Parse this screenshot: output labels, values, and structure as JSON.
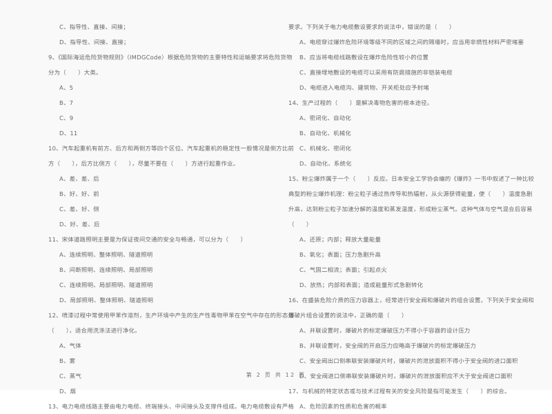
{
  "document": {
    "type": "exam-paper-scan",
    "language": "zh-CN",
    "footer": "第 2 页 共 12 页"
  },
  "left_column": {
    "blocks": [
      {
        "id": "q8-options-tail",
        "lines": [
          {
            "kind": "option",
            "text": "C、指导性、直接、间接；"
          },
          {
            "kind": "option",
            "text": "D、指导性、间接、直接；"
          }
        ]
      },
      {
        "id": "q9",
        "lines": [
          {
            "kind": "stem",
            "text": "9、《国际海运危险货物规则》（IMDGCode）根据危险货物的主要特性和运输要求将危险货物"
          },
          {
            "kind": "stem-cont",
            "text": "分为（　　）大类。"
          },
          {
            "kind": "option",
            "text": "A、5"
          },
          {
            "kind": "option",
            "text": "B、7"
          },
          {
            "kind": "option",
            "text": "C、9"
          },
          {
            "kind": "option",
            "text": "D、11"
          }
        ]
      },
      {
        "id": "q10",
        "lines": [
          {
            "kind": "stem",
            "text": "10、汽车起重机有前方、后方和两侧方等四个区位。汽车起重机的稳定性一般情况是侧方比前"
          },
          {
            "kind": "stem-cont",
            "text": "方（　　），后方比侧方（　　），尽量不要在（　　）方进行起重作业。"
          },
          {
            "kind": "option",
            "text": "A、差、差、后"
          },
          {
            "kind": "option",
            "text": "B、好、好、前"
          },
          {
            "kind": "option",
            "text": "C、差、好、侧"
          },
          {
            "kind": "option",
            "text": "D、好、差、后"
          }
        ]
      },
      {
        "id": "q11",
        "lines": [
          {
            "kind": "stem",
            "text": "11、宋体道路照明主要是为保证夜间交通的安全与畅通，可以分为（　　）"
          },
          {
            "kind": "option",
            "text": "A、连续照明、整体照明、隧道照明"
          },
          {
            "kind": "option",
            "text": "B、间断照明、连续照明、局部照明"
          },
          {
            "kind": "option",
            "text": "C、连续照明、局部照明、隧道照明"
          },
          {
            "kind": "option",
            "text": "D、局部照明、整体照明、隧道照明"
          }
        ]
      },
      {
        "id": "q12",
        "lines": [
          {
            "kind": "stem",
            "text": "12、喷漆过程中常使用甲苯作溶剂，生产环境中产生的生产性毒物甲苯在空气中存在的形态是"
          },
          {
            "kind": "stem-cont",
            "text": "（　　），适合用洗涤法进行净化。"
          },
          {
            "kind": "option",
            "text": "A、气体"
          },
          {
            "kind": "option",
            "text": "B、雾"
          },
          {
            "kind": "option",
            "text": "C、蒸气"
          },
          {
            "kind": "option",
            "text": "D、烟"
          }
        ]
      },
      {
        "id": "q13-stem-start",
        "lines": [
          {
            "kind": "stem",
            "text": "13、电力电缆线路主要由电力电缆、终端接头、中间接头及支撑件组成。电力电缆敷设有严格"
          }
        ]
      }
    ]
  },
  "right_column": {
    "blocks": [
      {
        "id": "q13-cont",
        "lines": [
          {
            "kind": "stem-cont",
            "text": "要求。下列关于电力电缆敷设要求的说法中，错误的是（　　）"
          },
          {
            "kind": "option",
            "text": "A、电缆穿过爆炸危险环境等级不同的区域之间的隔墙时，应当用非燃性材料严密堵塞"
          },
          {
            "kind": "option",
            "text": "B、应当将电缆线路敷设在爆炸危险性较小的位置"
          },
          {
            "kind": "option",
            "text": "C、直接埋地敷设的电缆可以采用有防腐措施的非铠装电缆"
          },
          {
            "kind": "option",
            "text": "D、电缆进入电缆沟、建筑物、开关柜处应予封堵"
          }
        ]
      },
      {
        "id": "q14",
        "lines": [
          {
            "kind": "stem",
            "text": "14、生产过程的（　　）是解决毒物危害的根本途径。"
          },
          {
            "kind": "option",
            "text": "A、密闭化、自动化"
          },
          {
            "kind": "option",
            "text": "B、自动化、机械化"
          },
          {
            "kind": "option",
            "text": "C、机械化、密闭化"
          },
          {
            "kind": "option",
            "text": "D、自动化、系统化"
          }
        ]
      },
      {
        "id": "q15",
        "lines": [
          {
            "kind": "stem",
            "text": "15、粉尘爆炸属于一个（　　）反应。日本安全工学协会编的《爆炸》一书中叙述了一种比较"
          },
          {
            "kind": "stem-cont",
            "text": "典型的粉尘爆炸机理：粉尘粒子通过热传导和热辐射，从火源获得能量，使（　　）温度急剧"
          },
          {
            "kind": "stem-cont",
            "text": "升高，达到粉尘粒子加速分解的温度和蒸发温度，形成粉尘蒸气。这种气体与空气混合后容易"
          },
          {
            "kind": "stem-cont",
            "text": "（　　）"
          },
          {
            "kind": "option",
            "text": "A、还原；内部；释放大量能量"
          },
          {
            "kind": "option",
            "text": "B、氧化；表面；压力急剧升高"
          },
          {
            "kind": "option",
            "text": "C、气固二相流；表面；引起点火"
          },
          {
            "kind": "option",
            "text": "D、放热；内部和表面；造成能量形式急剧转化"
          }
        ]
      },
      {
        "id": "q16",
        "lines": [
          {
            "kind": "stem",
            "text": "16、在盛装危险介质的压力容器上，经常进行安全阀和爆破片的组合设置。下列关于安全阀和"
          },
          {
            "kind": "stem-cont",
            "text": "爆破片组合设置的说法中，正确的是（　　）"
          },
          {
            "kind": "option",
            "text": "A、并联设置时，爆破片的标定爆破压力不得小于容器的设计压力"
          },
          {
            "kind": "option",
            "text": "B、并联设置时，安全阀的开启压力应略高于爆破片的标定爆破压力"
          },
          {
            "kind": "option",
            "text": "C、安全阀出口侧串联安装爆破片时，爆破片的泄放面积不得小于安全阀的进口面积"
          },
          {
            "kind": "option",
            "text": "D、安全阀进口侧串联安装爆破片时，爆破片的泄放面积应不大于安全阀进口面积"
          }
        ]
      },
      {
        "id": "q17",
        "lines": [
          {
            "kind": "stem",
            "text": "17、与机械的特定状态或与技术过程有关的安全风险是指可能发生（　　）的综合。"
          },
          {
            "kind": "option",
            "text": "A、危险因素的性质和危害的概率"
          }
        ]
      }
    ]
  }
}
